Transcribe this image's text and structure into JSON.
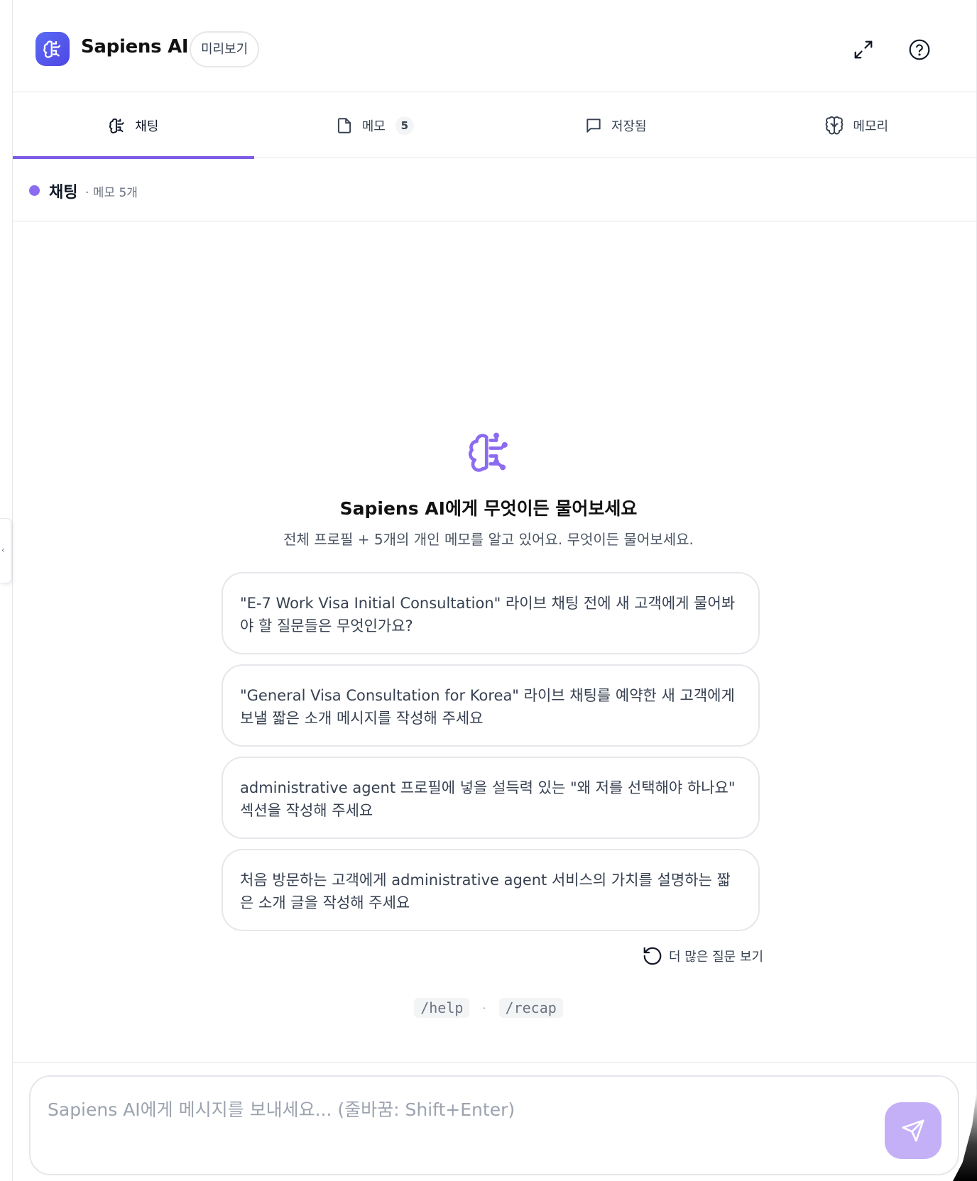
{
  "header": {
    "app_title": "Sapiens AI",
    "preview_badge": "미리보기",
    "logo_icon": "brain-icon",
    "expand_icon": "expand-icon",
    "help_icon": "help-circle-icon",
    "brand_color": "#4f46e5"
  },
  "tabs": [
    {
      "label": "채팅",
      "icon": "brain-icon",
      "active": true
    },
    {
      "label": "메모",
      "icon": "file-icon",
      "count": "5"
    },
    {
      "label": "저장됨",
      "icon": "chat-bubble-icon"
    },
    {
      "label": "메모리",
      "icon": "brain-outline-icon"
    }
  ],
  "status": {
    "title": "채팅",
    "subtitle": "· 메모 5개",
    "dot_color": "#8b6cf0"
  },
  "empty_state": {
    "icon": "brain-icon",
    "title": "Sapiens AI에게 무엇이든 물어보세요",
    "subtitle": "전체 프로필 + 5개의 개인 메모를 알고 있어요. 무엇이든 물어보세요."
  },
  "suggestions": [
    "\"E-7 Work Visa Initial Consultation\" 라이브 채팅 전에 새 고객에게 물어봐야 할 질문들은 무엇인가요?",
    "\"General Visa Consultation for Korea\" 라이브 채팅를 예약한 새 고객에게 보낼 짧은 소개 메시지를 작성해 주세요",
    "administrative agent 프로필에 넣을 설득력 있는 \"왜 저를 선택해야 하나요\" 섹션을 작성해 주세요",
    "처음 방문하는 고객에게 administrative agent 서비스의 가치를 설명하는 짧은 소개 글을 작성해 주세요"
  ],
  "more_questions": {
    "label": "더 많은 질문 보기",
    "icon": "refresh-icon"
  },
  "commands": [
    "/help",
    "/recap"
  ],
  "command_separator": "·",
  "composer": {
    "placeholder": "Sapiens AI에게 메시지를 보내세요... (줄바꿈: Shift+Enter)",
    "value": "",
    "send_icon": "send-icon",
    "send_color": "#c4b0f7"
  },
  "accent_color": "#7c5ce6"
}
